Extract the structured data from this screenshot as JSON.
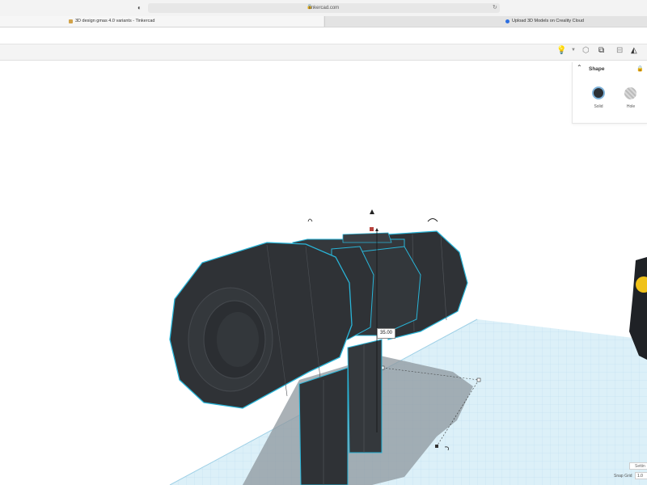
{
  "browser": {
    "url": "tinkercad.com",
    "tabs": [
      {
        "label": "3D design gmas 4.0 variants - Tinkercad"
      },
      {
        "label": "Upload 3D Models on Creality Cloud"
      }
    ]
  },
  "shape_panel": {
    "title": "Shape",
    "solid_label": "Solid",
    "hole_label": "Hole"
  },
  "workplane": {
    "dimension_value": "35.00"
  },
  "footer": {
    "settings_label": "Settin",
    "snap_grid_label": "Snap Grid",
    "snap_grid_value": "1.0"
  },
  "colors": {
    "selection_outline": "#29b5d8",
    "model_fill": "#2f3236",
    "grid_bg": "#dbeef7",
    "grid_line": "#b9dbed"
  }
}
